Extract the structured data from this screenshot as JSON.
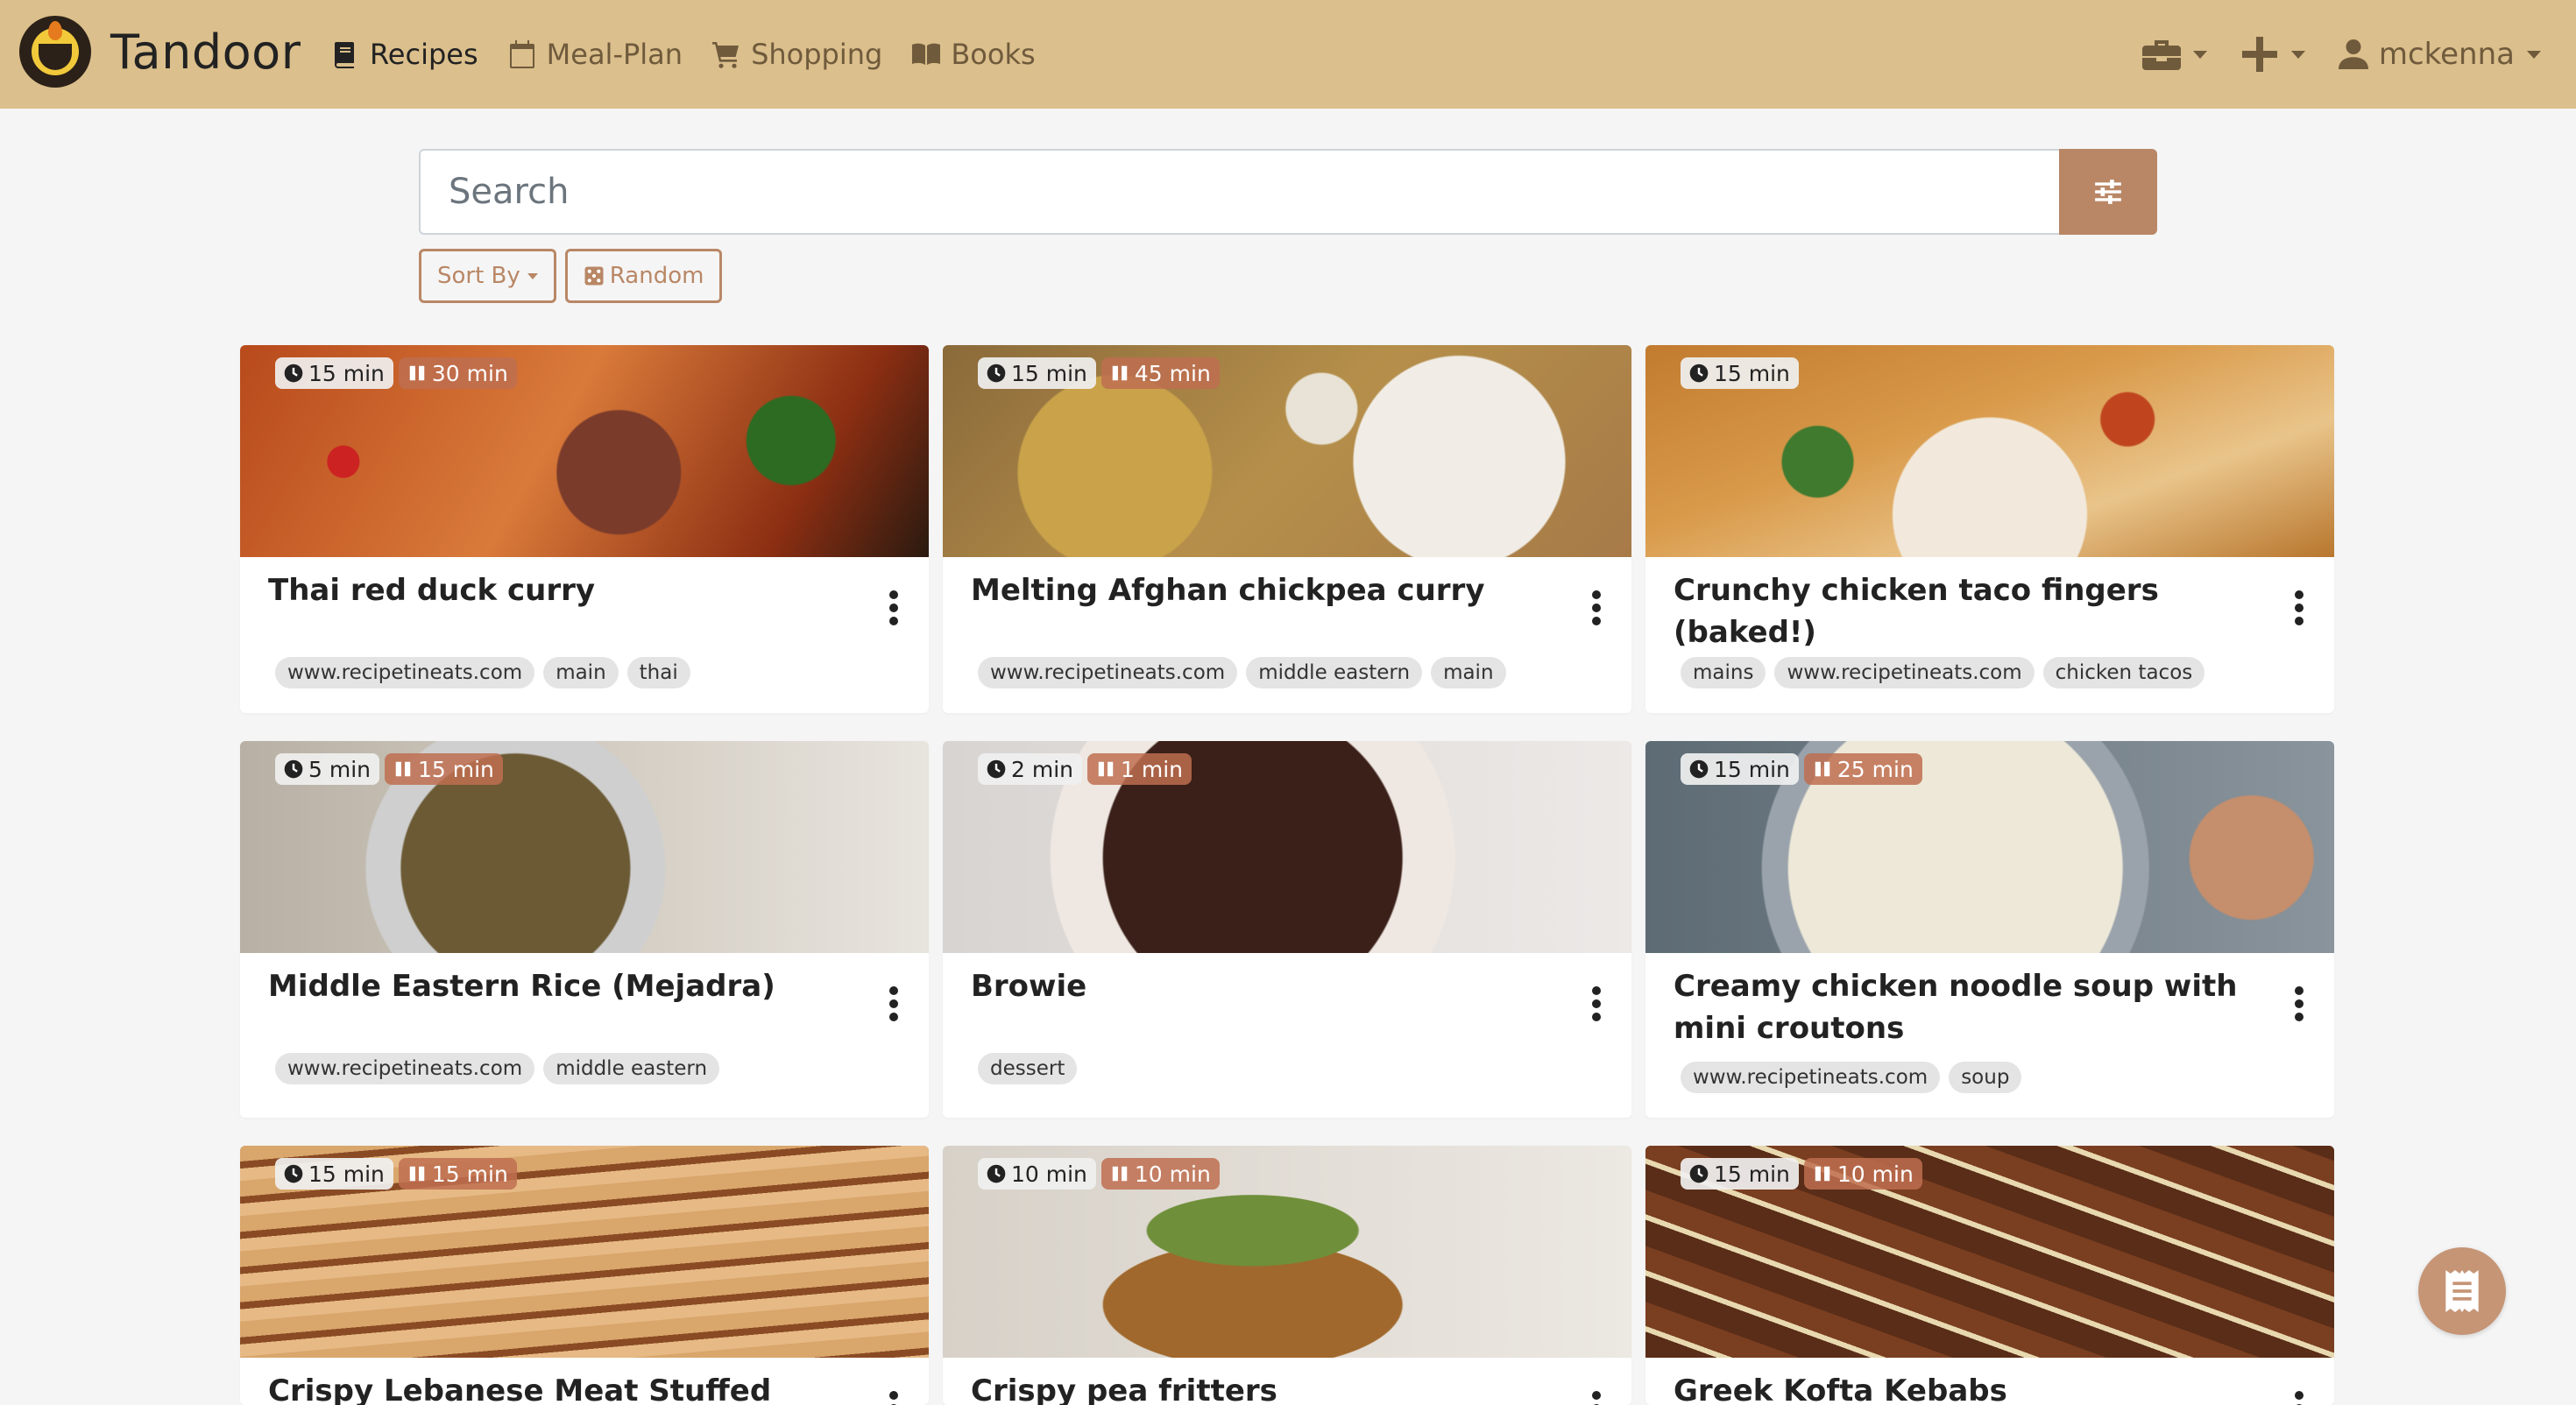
{
  "brand": {
    "name": "Tandoor"
  },
  "nav": {
    "recipes": "Recipes",
    "meal_plan": "Meal-Plan",
    "shopping": "Shopping",
    "books": "Books",
    "user": "mckenna"
  },
  "search": {
    "placeholder": "Search",
    "value": ""
  },
  "buttons": {
    "sort_by": "Sort By",
    "random": "Random"
  },
  "colors": {
    "navbar": "#dbbf8c",
    "accent": "#b98766"
  },
  "recipes": [
    {
      "title": "Thai red duck curry",
      "working": "15 min",
      "waiting": "30 min",
      "tags": [
        "www.recipetineats.com",
        "main",
        "thai"
      ]
    },
    {
      "title": "Melting Afghan chickpea curry",
      "working": "15 min",
      "waiting": "45 min",
      "tags": [
        "www.recipetineats.com",
        "middle eastern",
        "main"
      ]
    },
    {
      "title": "Crunchy chicken taco fingers (baked!)",
      "working": "15 min",
      "waiting": "",
      "tags": [
        "mains",
        "www.recipetineats.com",
        "chicken tacos"
      ]
    },
    {
      "title": "Middle Eastern Rice (Mejadra)",
      "working": "5 min",
      "waiting": "15 min",
      "tags": [
        "www.recipetineats.com",
        "middle eastern"
      ]
    },
    {
      "title": "Browie",
      "working": "2 min",
      "waiting": "1 min",
      "tags": [
        "dessert"
      ]
    },
    {
      "title": "Creamy chicken noodle soup with mini croutons",
      "working": "15 min",
      "waiting": "25 min",
      "tags": [
        "www.recipetineats.com",
        "soup"
      ]
    },
    {
      "title": "Crispy Lebanese Meat Stuffed Pita -",
      "working": "15 min",
      "waiting": "15 min",
      "tags": []
    },
    {
      "title": "Crispy pea fritters",
      "working": "10 min",
      "waiting": "10 min",
      "tags": []
    },
    {
      "title": "Greek Kofta Kebabs",
      "working": "15 min",
      "waiting": "10 min",
      "tags": []
    }
  ]
}
